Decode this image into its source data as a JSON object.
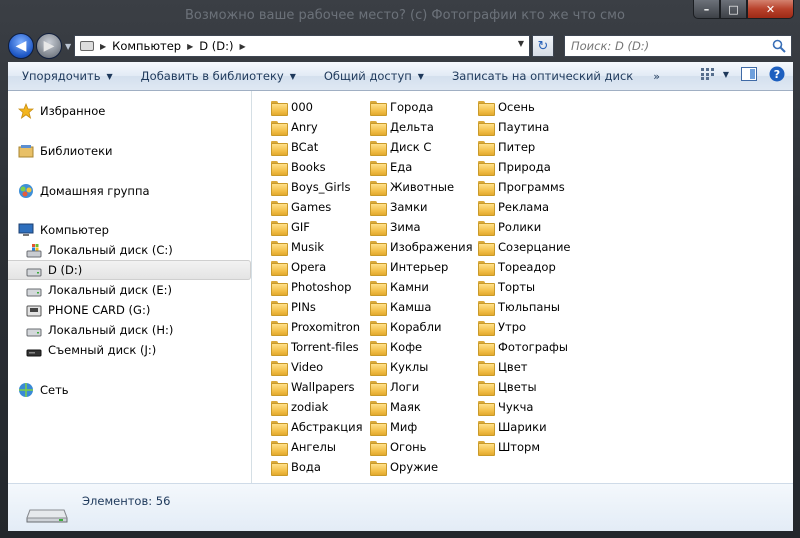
{
  "window": {
    "title": "Возможно ваше рабочее место? (с) Фотографии кто же что смотрит",
    "controls": {
      "minimize": "–",
      "maximize": "□",
      "close": "✕"
    }
  },
  "address": {
    "crumbs": [
      "Компьютер",
      "D (D:)"
    ],
    "search_placeholder": "Поиск: D (D:)"
  },
  "toolbar": {
    "items": [
      {
        "label": "Упорядочить"
      },
      {
        "label": "Добавить в библиотеку"
      },
      {
        "label": "Общий доступ"
      },
      {
        "label": "Записать на оптический диск"
      }
    ],
    "more": "»"
  },
  "sidebar": {
    "favorites": "Избранное",
    "libraries": "Библиотеки",
    "homegroup": "Домашняя группа",
    "computer": "Компьютер",
    "drives": [
      "Локальный диск (C:)",
      "D (D:)",
      "Локальный диск (E:)",
      "PHONE CARD (G:)",
      "Локальный диск (H:)",
      "Съемный диск (J:)"
    ],
    "network": "Сеть"
  },
  "folders": {
    "col1": [
      "000",
      "Anry",
      "BCat",
      "Books",
      "Boys_Girls",
      "Games",
      "GIF",
      "Musik",
      "Opera",
      "Photoshop",
      "PINs",
      "Proxomitron",
      "Torrent-files",
      "Video",
      "Wallpapers",
      "zodiak",
      "Абстракция",
      "Ангелы",
      "Вода"
    ],
    "col2": [
      "Города",
      "Дельта",
      "Диск С",
      "Еда",
      "Животные",
      "Замки",
      "Зима",
      "Изображения",
      "Интерьер",
      "Камни",
      "Камша",
      "Корабли",
      "Кофе",
      "Куклы",
      "Логи",
      "Маяк",
      "Миф",
      "Огонь",
      "Оружие"
    ],
    "col3": [
      "Осень",
      "Паутина",
      "Питер",
      "Природа",
      "Программs",
      "Реклама",
      "Ролики",
      "Созерцание",
      "Тореадор",
      "Торты",
      "Тюльпаны",
      "Утро",
      "Фотографы",
      "Цвет",
      "Цветы",
      "Чукча",
      "Шарики",
      "Шторм"
    ]
  },
  "status": {
    "count_text": "Элементов: 56"
  }
}
